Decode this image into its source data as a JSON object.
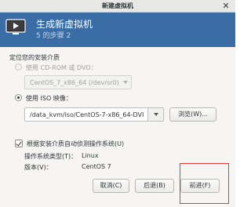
{
  "window": {
    "title": "新建虚拟机"
  },
  "banner": {
    "title": "生成新虚拟机",
    "step": "5 的步骤 2"
  },
  "install_media": {
    "section_label": "定位您的安装介质",
    "cdrom": {
      "label": "使用  CD-ROM 或  DVD：",
      "selected": false,
      "enabled": false,
      "device_value": "CentOS_7_x86_64 (/dev/sr0)"
    },
    "iso": {
      "label": "使用  ISO 映像：",
      "selected": true,
      "path_value": "/data_kvm/iso/CentOS-7-x86_64-DVI",
      "browse_label": "浏览(W)..."
    }
  },
  "detect_os": {
    "label": "根据安装介质自动侦测操作系统(U)",
    "checked": true,
    "os_type_label": "操作系统类型(T)：",
    "os_type_value": "Linux",
    "version_label": "版本(V)：",
    "version_value": "CentOS 7"
  },
  "buttons": {
    "cancel": "取消(C)",
    "back": "后退(B)",
    "forward": "前进(F)"
  },
  "colors": {
    "banner_bg": "#3a6da6",
    "highlight_box": "#e53935"
  },
  "icons": {
    "close": "close-icon",
    "banner": "monitor-play-icon"
  }
}
